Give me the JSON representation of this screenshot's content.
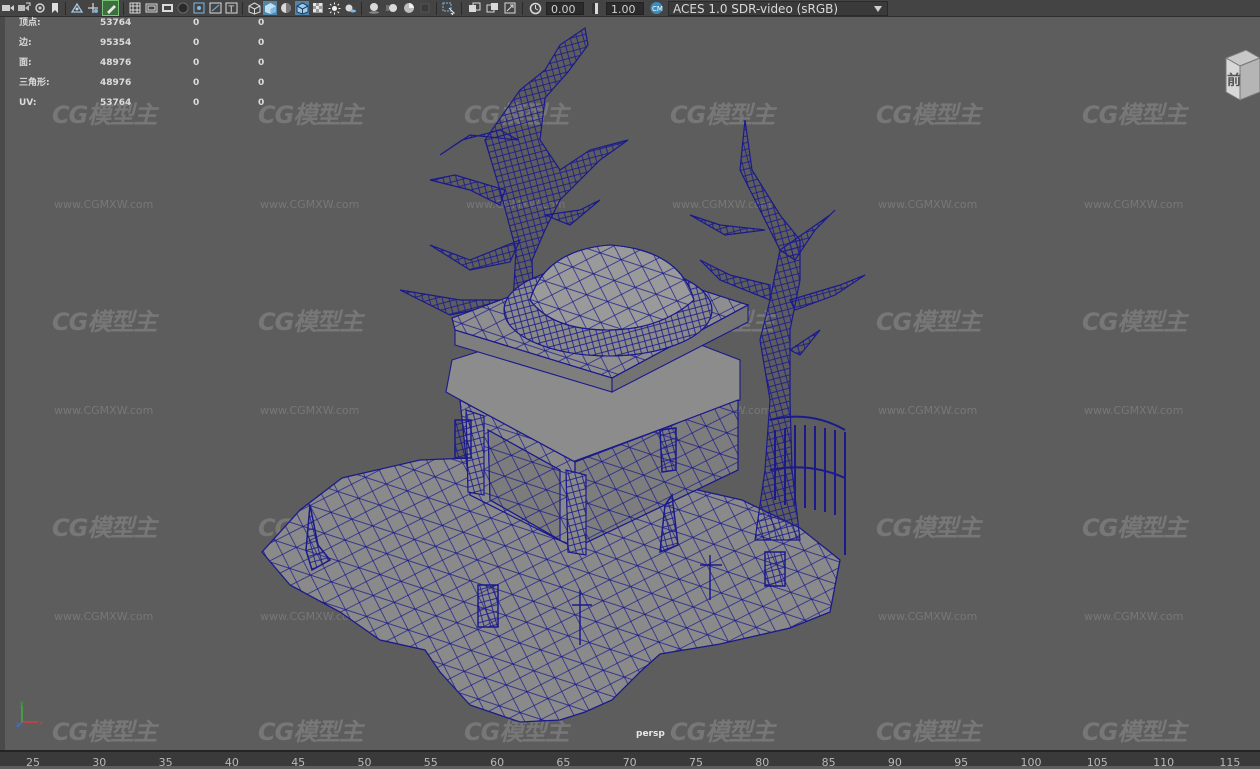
{
  "toolbar": {
    "icons": [
      "camera-icon",
      "select-camera-icon",
      "camera-attributes-icon",
      "bookmark-icon",
      "image-plane-icon",
      "transform-grid-icon",
      "grease-pencil-icon",
      "grid-icon",
      "film-gate-icon",
      "resolution-gate-icon",
      "gate-mask-icon",
      "field-chart-icon",
      "safe-action-icon",
      "safe-title-icon",
      "wireframe-icon",
      "smooth-shade-icon",
      "default-material-icon",
      "wireframe-on-shaded-icon",
      "xray-icon",
      "use-all-lights-icon",
      "shadows-icon",
      "ambient-occlusion-icon",
      "motion-blur-icon",
      "anti-aliasing-icon",
      "depth-of-field-icon",
      "isolate-select-icon",
      "xray-joints-icon",
      "xray-active-icon",
      "backface-icon"
    ],
    "exposure_value": "0.00",
    "gamma_value": "1.00",
    "color_space": "ACES 1.0 SDR-video (sRGB)"
  },
  "hud": {
    "rows": [
      {
        "label": "顶点:",
        "total": "53764",
        "selected": "0",
        "component": "0"
      },
      {
        "label": "边:",
        "total": "95354",
        "selected": "0",
        "component": "0"
      },
      {
        "label": "面:",
        "total": "48976",
        "selected": "0",
        "component": "0"
      },
      {
        "label": "三角形:",
        "total": "48976",
        "selected": "0",
        "component": "0"
      },
      {
        "label": "UV:",
        "total": "53764",
        "selected": "0",
        "component": "0"
      }
    ]
  },
  "viewport": {
    "camera": "persp",
    "viewcube_face": "前",
    "wire_color": "#1a1a8c",
    "mesh_fill": "#8a8a8a",
    "background": "#5d5d5d"
  },
  "watermark": {
    "logo": "CG模型主",
    "url": "www.CGMXW.com"
  },
  "timeline": {
    "ticks": [
      "25",
      "30",
      "35",
      "40",
      "45",
      "50",
      "55",
      "60",
      "65",
      "70",
      "75",
      "80",
      "85",
      "90",
      "95",
      "100",
      "105",
      "110",
      "115"
    ]
  },
  "colors": {
    "toolbar_bg": "#444444",
    "field_bg": "#2b2b2b",
    "accent_blue": "#3c8dbc",
    "hud_text": "#dcdcdc"
  }
}
